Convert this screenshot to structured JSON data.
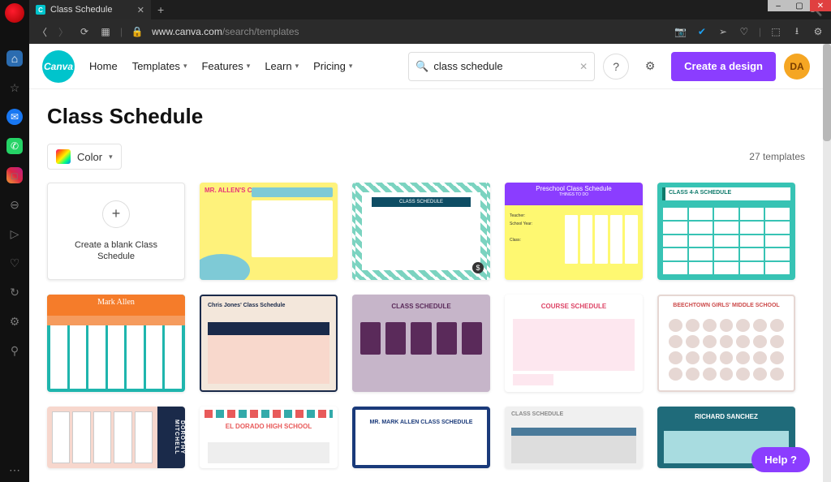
{
  "window": {
    "title": "Class Schedule"
  },
  "addr": {
    "lock": "🔒",
    "domain": "www.canva.com",
    "path": "/search/templates"
  },
  "nav": {
    "home": "Home",
    "templates": "Templates",
    "features": "Features",
    "learn": "Learn",
    "pricing": "Pricing"
  },
  "search": {
    "value": "class schedule"
  },
  "create_btn": "Create a design",
  "avatar": "DA",
  "canva_logo": "Canva",
  "page_title": "Class Schedule",
  "filters": {
    "color": "Color"
  },
  "count": "27 templates",
  "blank_label": "Create a blank Class Schedule",
  "templates": {
    "mrallen": "MR. ALLEN'S CLASS SCHEDULE",
    "floral": "CLASS SCHEDULE",
    "presch_title": "Preschool Class Schedule",
    "presch_sub": "THINGS TO DO",
    "presch_side": "Teacher:\nSchool Year:\n\nClass:",
    "class4a": "CLASS 4-A SCHEDULE",
    "mark": "Mark Allen",
    "chris": "Chris Jones' Class Schedule",
    "purple": "CLASS SCHEDULE",
    "course": "COURSE SCHEDULE",
    "beech": "BEECHTOWN GIRLS' MIDDLE SCHOOL",
    "doro": "DOROTHY MITCHELL",
    "eldo": "EL DORADO HIGH SCHOOL",
    "mrmark": "MR. MARK ALLEN CLASS SCHEDULE",
    "classsch": "CLASS SCHEDULE",
    "rich": "RICHARD SANCHEZ"
  },
  "help": "Help ?"
}
